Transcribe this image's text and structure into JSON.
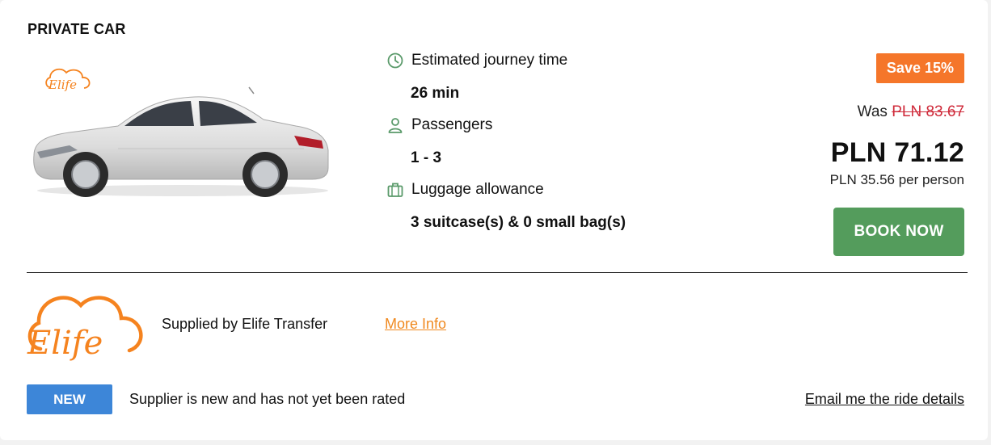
{
  "card": {
    "title": "PRIVATE CAR",
    "logo_text": "Elife",
    "features": {
      "journey_label": "Estimated journey time",
      "journey_value": "26 min",
      "passengers_label": "Passengers",
      "passengers_value": "1 - 3",
      "luggage_label": "Luggage allowance",
      "luggage_value": "3 suitcase(s) & 0 small bag(s)"
    },
    "pricing": {
      "save_badge": "Save 15%",
      "was_label": "Was",
      "was_price": "PLN 83.67",
      "price": "PLN 71.12",
      "per_person": "PLN 35.56 per person",
      "book_button": "BOOK NOW"
    },
    "supplier": {
      "supplied_by": "Supplied by Elife Transfer",
      "more_info": "More Info",
      "new_badge": "NEW",
      "rating_text": "Supplier is new and has not yet been rated",
      "email_link": "Email me the ride details"
    },
    "colors": {
      "accent_orange": "#f5762a",
      "book_green": "#549c5c",
      "icon_green": "#5a9a6a",
      "new_blue": "#3d86d8",
      "strike_red": "#cf2a3a",
      "link_orange": "#f0891f"
    },
    "icons": [
      "clock-icon",
      "user-icon",
      "luggage-icon"
    ]
  }
}
